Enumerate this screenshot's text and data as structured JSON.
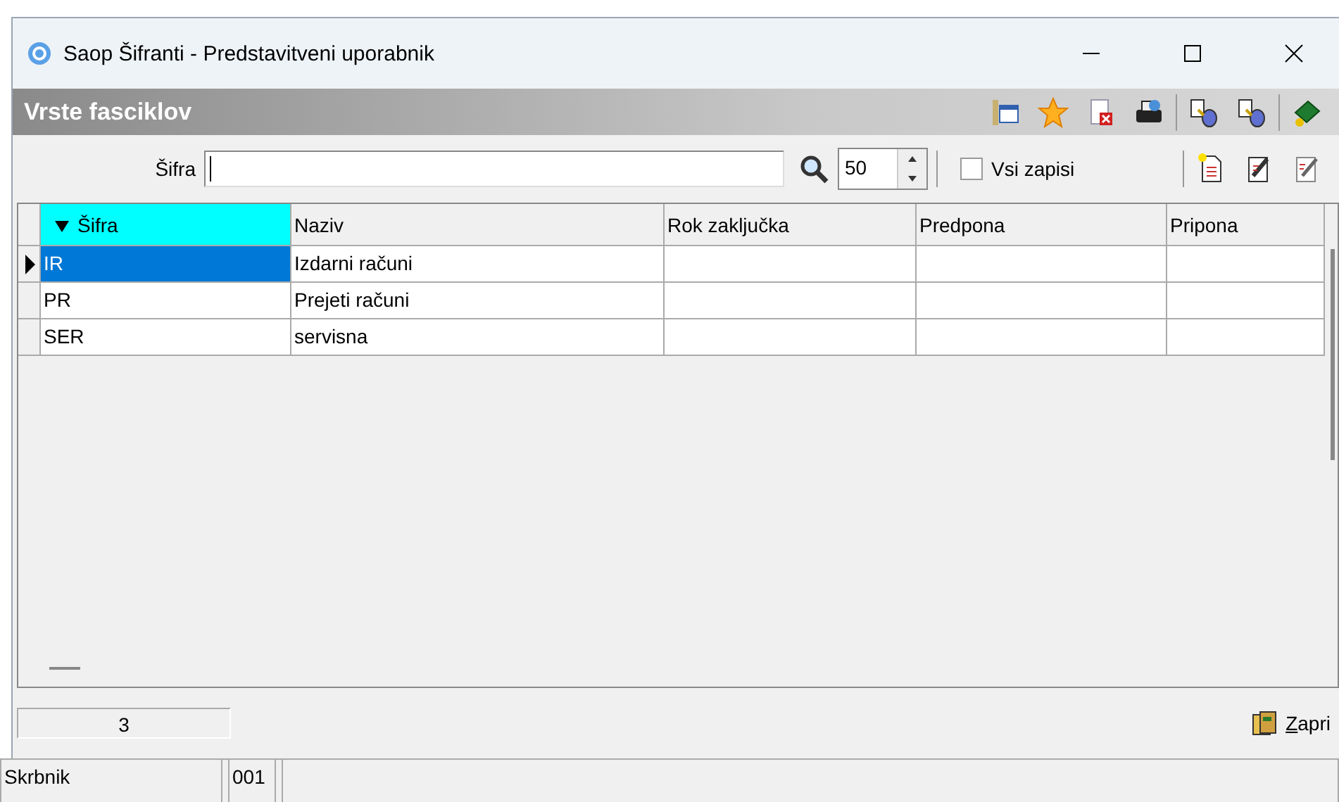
{
  "window": {
    "title": "Saop Šifranti - Predstavitveni uporabnik"
  },
  "panel": {
    "title": "Vrste fasciklov"
  },
  "filter": {
    "label": "Šifra",
    "limit": "50",
    "all_records": {
      "label": "Vsi zapisi",
      "checked": false
    }
  },
  "table": {
    "columns": [
      {
        "label": "Šifra",
        "sorted": true
      },
      {
        "label": "Naziv",
        "sorted": false
      },
      {
        "label": "Rok zaključka",
        "sorted": false
      },
      {
        "label": "Predpona",
        "sorted": false
      },
      {
        "label": "Pripona",
        "sorted": false
      }
    ],
    "rows": [
      {
        "selected": true,
        "cells": [
          "IR",
          "Izdarni računi",
          "",
          "",
          ""
        ]
      },
      {
        "selected": false,
        "cells": [
          "PR",
          "Prejeti računi",
          "",
          "",
          ""
        ]
      },
      {
        "selected": false,
        "cells": [
          "SER",
          "servisna",
          "",
          "",
          ""
        ]
      }
    ]
  },
  "record_count": "3",
  "close_button": "Zapri",
  "status_bar": {
    "field": "Skrbnik",
    "value": "001"
  }
}
